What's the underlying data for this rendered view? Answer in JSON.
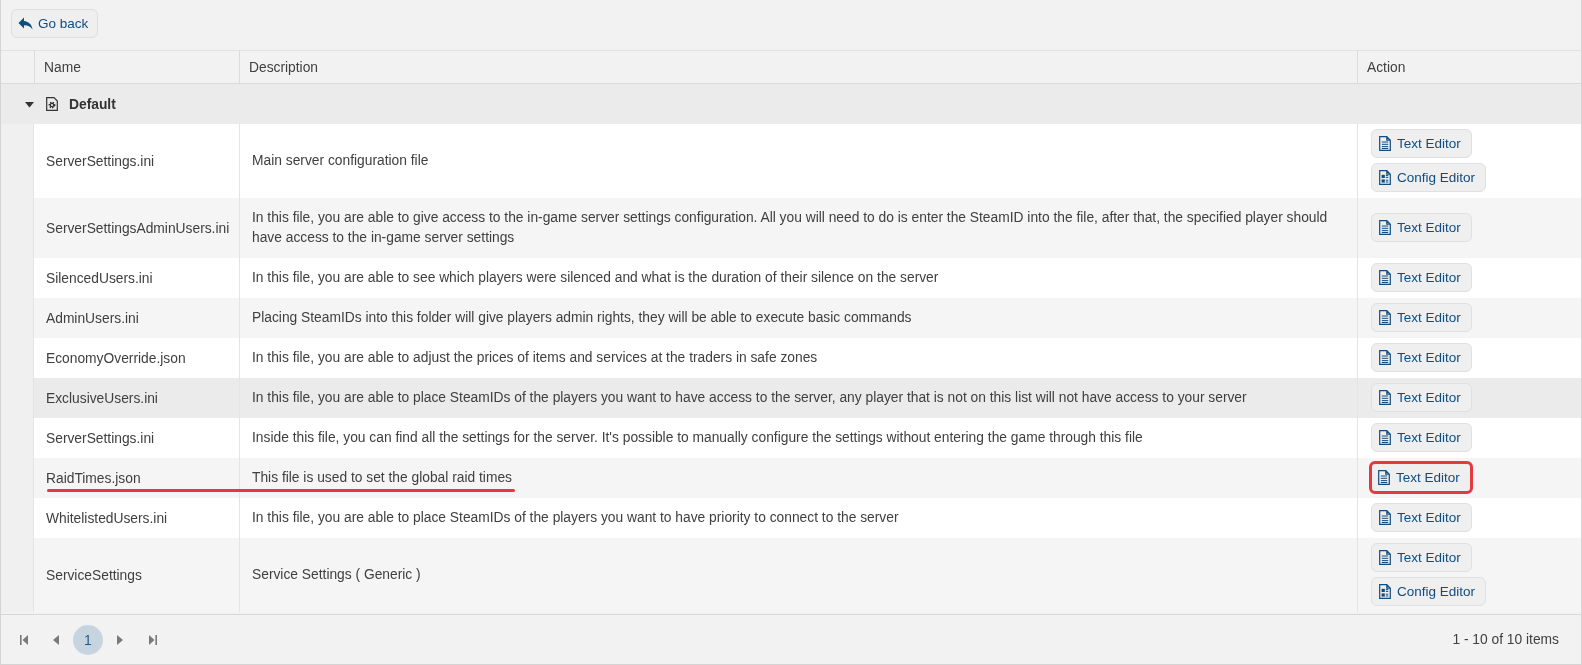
{
  "toolbar": {
    "back_button": "Go back"
  },
  "table": {
    "columns": [
      "Name",
      "Description",
      "Action"
    ],
    "groups": [
      {
        "title": "Default",
        "expanded": true,
        "rows": [
          {
            "name": "ServerSettings.ini",
            "description": "Main server configuration file",
            "hovered": false,
            "underlined": false,
            "actions": [
              {
                "kind": "text",
                "label": "Text Editor",
                "outlined": false
              },
              {
                "kind": "config",
                "label": "Config Editor",
                "outlined": false
              }
            ]
          },
          {
            "name": "ServerSettingsAdminUsers.ini",
            "description": "In this file, you are able to give access to the in-game server settings configuration. All you will need to do is enter the SteamID into the file, after that, the specified player should have access to the in-game server settings",
            "hovered": false,
            "underlined": false,
            "actions": [
              {
                "kind": "text",
                "label": "Text Editor",
                "outlined": false
              }
            ]
          },
          {
            "name": "SilencedUsers.ini",
            "description": "In this file, you are able to see which players were silenced and what is the duration of their silence on the server",
            "hovered": false,
            "underlined": false,
            "actions": [
              {
                "kind": "text",
                "label": "Text Editor",
                "outlined": false
              }
            ]
          },
          {
            "name": "AdminUsers.ini",
            "description": "Placing SteamIDs into this folder will give players admin rights, they will be able to execute basic commands",
            "hovered": false,
            "underlined": false,
            "actions": [
              {
                "kind": "text",
                "label": "Text Editor",
                "outlined": false
              }
            ]
          },
          {
            "name": "EconomyOverride.json",
            "description": "In this file, you are able to adjust the prices of items and services at the traders in safe zones",
            "hovered": false,
            "underlined": false,
            "actions": [
              {
                "kind": "text",
                "label": "Text Editor",
                "outlined": false
              }
            ]
          },
          {
            "name": "ExclusiveUsers.ini",
            "description": "In this file, you are able to place SteamIDs of the players you want to have access to the server, any player that is not on this list will not have access to your server",
            "hovered": true,
            "underlined": false,
            "actions": [
              {
                "kind": "text",
                "label": "Text Editor",
                "outlined": false
              }
            ]
          },
          {
            "name": "ServerSettings.ini",
            "description": "Inside this file, you can find all the settings for the server. It's possible to manually configure the settings without entering the game through this file",
            "hovered": false,
            "underlined": false,
            "actions": [
              {
                "kind": "text",
                "label": "Text Editor",
                "outlined": false
              }
            ]
          },
          {
            "name": "RaidTimes.json",
            "description": "This file is used to set the global raid times",
            "hovered": false,
            "underlined": true,
            "actions": [
              {
                "kind": "text",
                "label": "Text Editor",
                "outlined": true
              }
            ]
          },
          {
            "name": "WhitelistedUsers.ini",
            "description": "In this file, you are able to place SteamIDs of the players you want to have priority to connect to the server",
            "hovered": false,
            "underlined": false,
            "actions": [
              {
                "kind": "text",
                "label": "Text Editor",
                "outlined": false
              }
            ]
          },
          {
            "name": "ServiceSettings",
            "description": "Service Settings ( Generic )",
            "hovered": false,
            "underlined": false,
            "actions": [
              {
                "kind": "text",
                "label": "Text Editor",
                "outlined": false
              },
              {
                "kind": "config",
                "label": "Config Editor",
                "outlined": false
              }
            ]
          }
        ]
      }
    ]
  },
  "pager": {
    "pages": [
      {
        "label": "1",
        "selected": true
      }
    ],
    "summary": "1 - 10 of 10 items"
  }
}
